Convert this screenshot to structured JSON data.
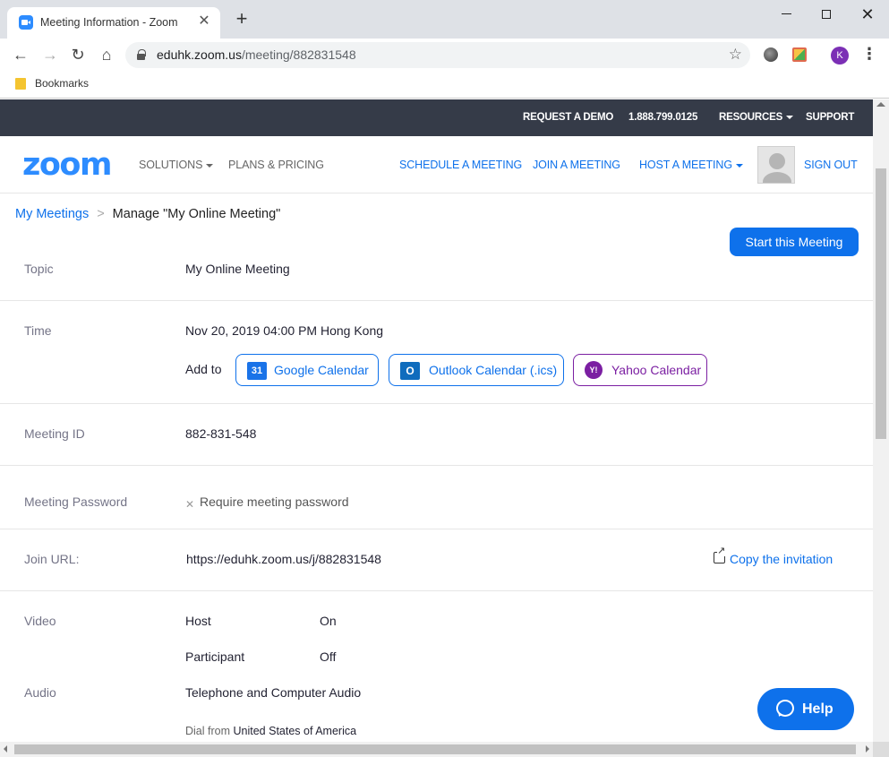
{
  "browser": {
    "tab_title": "Meeting Information - Zoom",
    "tab_close": "✕",
    "new_tab": "+",
    "url_host": "eduhk.zoom.us",
    "url_path": "/meeting/882831548",
    "profile_initial": "K",
    "bookmarks_label": "Bookmarks",
    "icons": [
      "back-icon",
      "forward-icon",
      "reload-icon",
      "home-icon",
      "lock-icon",
      "star-icon",
      "menu-icon"
    ]
  },
  "top_strip": {
    "request_demo": "REQUEST A DEMO",
    "phone": "1.888.799.0125",
    "resources": "RESOURCES",
    "support": "SUPPORT"
  },
  "main_nav": {
    "logo": "zoom",
    "solutions": "SOLUTIONS",
    "plans_pricing": "PLANS & PRICING",
    "schedule": "SCHEDULE A MEETING",
    "join": "JOIN A MEETING",
    "host": "HOST A MEETING",
    "sign_out": "SIGN OUT"
  },
  "breadcrumb": {
    "parent": "My Meetings",
    "separator": ">",
    "current": "Manage \"My Online Meeting\""
  },
  "start_button": "Start this Meeting",
  "details": {
    "topic_label": "Topic",
    "topic_value": "My Online Meeting",
    "time_label": "Time",
    "time_value": "Nov 20, 2019 04:00 PM Hong Kong",
    "add_to_label": "Add to",
    "google_calendar": "Google Calendar",
    "google_icon_text": "31",
    "outlook_calendar": "Outlook Calendar (.ics)",
    "outlook_icon_text": "O",
    "yahoo_calendar": "Yahoo Calendar",
    "yahoo_icon_text": "Y!",
    "meeting_id_label": "Meeting ID",
    "meeting_id_value": "882-831-548",
    "password_label": "Meeting Password",
    "password_mark": "✕",
    "password_value": "Require meeting password",
    "join_url_label": "Join URL:",
    "join_url_value": "https://eduhk.zoom.us/j/882831548",
    "copy_invitation": "Copy the invitation",
    "video_label": "Video",
    "host_label": "Host",
    "host_value": "On",
    "participant_label": "Participant",
    "participant_value": "Off",
    "audio_label": "Audio",
    "audio_value": "Telephone and Computer Audio",
    "dial_from_label": "Dial from",
    "dial_from_value": "United States of America"
  },
  "help_button": "Help",
  "colors": {
    "zoom_blue": "#0e71eb",
    "logo_blue": "#2d8cff",
    "top_strip_bg": "#353b48",
    "yahoo_purple": "#7b1fa2"
  }
}
